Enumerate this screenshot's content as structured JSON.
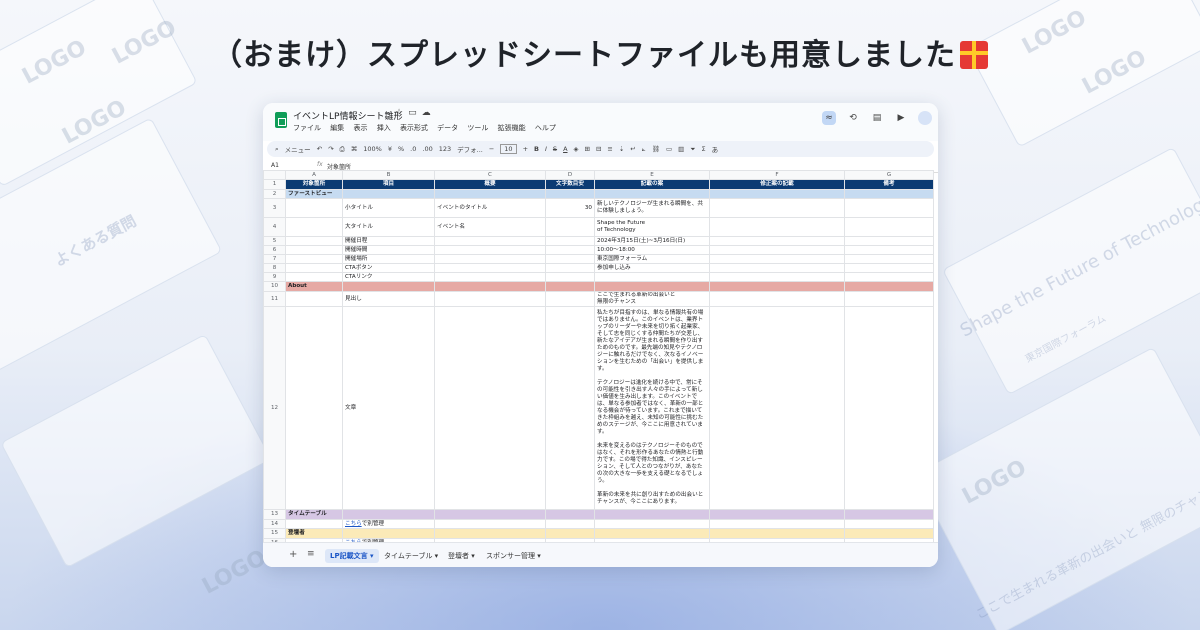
{
  "headline": "（おまけ）スプレッドシートファイルも用意しました",
  "gift_icon": "gift-emoji-icon",
  "background": {
    "logo_marks": [
      "LOGO",
      "LOGO",
      "LOGO",
      "LOGO",
      "LOGO",
      "LOGO",
      "LOGO"
    ],
    "faq_heading": "よくある質問",
    "hero_text": "Shape the Future of Technology",
    "venue_tag": "東京国際フォーラム",
    "bottom_text": "ここで生まれる革新の出会いと 無限のチャンス"
  },
  "window": {
    "title": "イベントLP情報シート雛形",
    "menu": [
      "ファイル",
      "編集",
      "表示",
      "挿入",
      "表示形式",
      "データ",
      "ツール",
      "拡張機能",
      "ヘルプ"
    ],
    "toolbar": {
      "search": "メニュー",
      "zoom": "100%",
      "currency": "¥",
      "percent": "%",
      "dec1": ".0",
      "dec2": ".00",
      "num": "123",
      "font": "デフォ...",
      "minus": "−",
      "font_size": "10",
      "plus": "+",
      "bold": "B",
      "italic": "I",
      "strike": "S",
      "textcolor": "A",
      "sigma": "Σ",
      "lang": "あ"
    },
    "formula": {
      "cell_ref": "A1",
      "fx": "fx",
      "value": "対象箇所"
    },
    "columns": [
      "A",
      "B",
      "C",
      "D",
      "E",
      "F",
      "G"
    ],
    "header_row": [
      "対象箇所",
      "項目",
      "概要",
      "文字数目安",
      "記載の案",
      "修正案の記載",
      "備考"
    ],
    "rows": [
      {
        "n": "2",
        "type": "sec-blue",
        "a": "ファーストビュー",
        "b": "",
        "c": "",
        "d": "",
        "e": ""
      },
      {
        "n": "3",
        "type": "",
        "a": "",
        "b": "小タイトル",
        "c": "イベントのタイトル",
        "d": "30",
        "e": "新しいテクノロジーが生まれる瞬間を、共に体験しましょう。"
      },
      {
        "n": "4",
        "type": "",
        "a": "",
        "b": "大タイトル",
        "c": "イベント名",
        "d": "",
        "e": "Shape the Future\nof Technology"
      },
      {
        "n": "5",
        "type": "",
        "a": "",
        "b": "開催日程",
        "c": "",
        "d": "",
        "e": "2024年3月15日(土)~3月16日(日)"
      },
      {
        "n": "6",
        "type": "",
        "a": "",
        "b": "開催時間",
        "c": "",
        "d": "",
        "e": "10:00〜18:00"
      },
      {
        "n": "7",
        "type": "",
        "a": "",
        "b": "開催場所",
        "c": "",
        "d": "",
        "e": "東京国際フォーラム"
      },
      {
        "n": "8",
        "type": "",
        "a": "",
        "b": "CTAボタン",
        "c": "",
        "d": "",
        "e": "参加申し込み"
      },
      {
        "n": "9",
        "type": "",
        "a": "",
        "b": "CTAリンク",
        "c": "",
        "d": "",
        "e": ""
      },
      {
        "n": "10",
        "type": "sec-red",
        "a": "About",
        "b": "",
        "c": "",
        "d": "",
        "e": ""
      },
      {
        "n": "11",
        "type": "",
        "a": "",
        "b": "見出し",
        "c": "",
        "d": "",
        "e": "ここで生まれる革新の出会いと\n無限のチャンス"
      },
      {
        "n": "12",
        "type": "",
        "a": "",
        "b": "文章",
        "c": "",
        "d": "",
        "e": "私たちが目指すのは、単なる情報共有の場ではありません。このイベントは、業界トップのリーダーや未来を切り拓く起業家、そして志を同じくする仲間たちが交差し、新たなアイデアが生まれる瞬間を作り出すためのものです。最先端の知見やテクノロジーに触れるだけでなく、次なるイノベーションを生むための「出会い」を提供します。\n\nテクノロジーは進化を続ける中で、常にその可能性を引き出す人々の手によって新しい価値を生み出します。このイベントでは、単なる参加者ではなく、革新の一部となる機会が待っています。これまで描いてきた枠組みを越え、未知の可能性に挑むためのステージが、今ここに用意されています。\n\n未来を変えるのはテクノロジーそのものではなく、それを形作るあなたの情熱と行動力です。この場で得た知識、インスピレーション、そして人とのつながりが、あなたの次の大きな一歩を支える礎となるでしょう。\n\n革新の未来を共に創り出すための出会いとチャンスが、今ここにあります。"
      },
      {
        "n": "13",
        "type": "sec-purple",
        "a": "タイムテーブル",
        "b": "",
        "c": "",
        "d": "",
        "e": ""
      },
      {
        "n": "14",
        "type": "",
        "a": "",
        "b": "こちらで別管理",
        "c": "",
        "d": "",
        "e": "",
        "blink": "こちら"
      },
      {
        "n": "15",
        "type": "sec-yellow",
        "a": "登壇者",
        "b": "",
        "c": "",
        "d": "",
        "e": ""
      },
      {
        "n": "16",
        "type": "",
        "a": "",
        "b": "こちらで別管理",
        "c": "",
        "d": "",
        "e": "",
        "blink": "こちら"
      }
    ],
    "tabs": [
      "LP記載文言",
      "タイムテーブル",
      "登壇者",
      "スポンサー管理"
    ]
  }
}
